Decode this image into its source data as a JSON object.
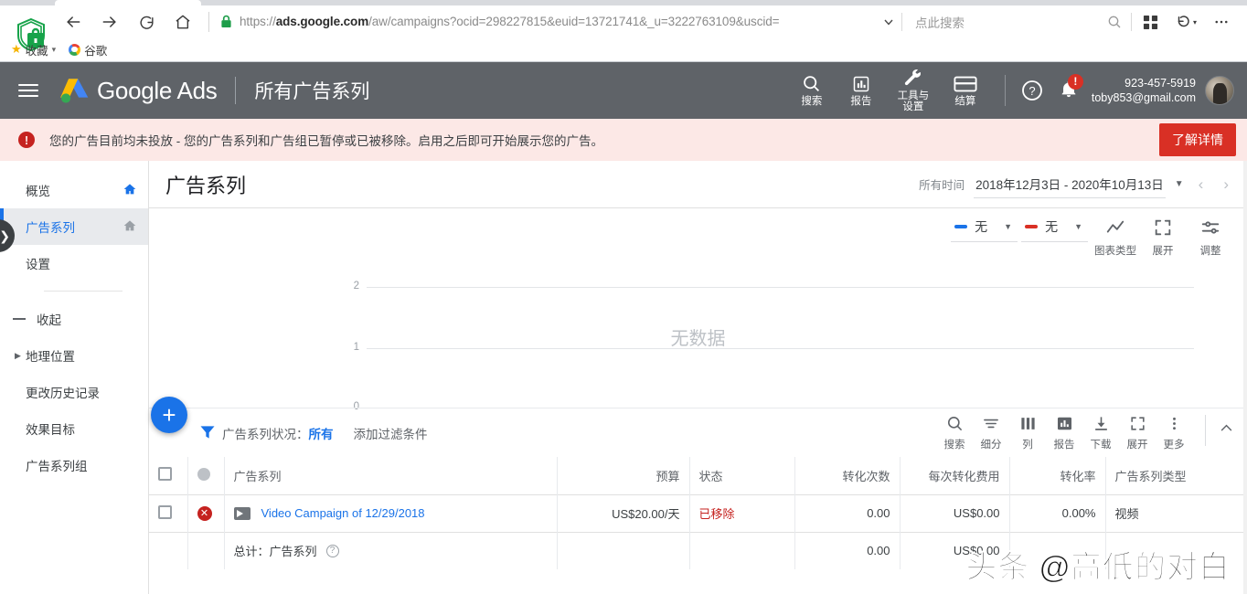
{
  "browser": {
    "url_prefix": "https://",
    "url_domain": "ads.google.com",
    "url_path": "/aw/campaigns?ocid=298227815&euid=13721741&_u=3222763109&uscid=",
    "search_placeholder": "点此搜索",
    "bookmarks": [
      {
        "label": "收藏",
        "icon": "star-icon"
      },
      {
        "label": "谷歌",
        "icon": "google-logo-icon"
      }
    ],
    "nav": {
      "back": "back-icon",
      "forward": "forward-icon",
      "reload": "reload-icon",
      "home": "home-icon"
    }
  },
  "header": {
    "brand": "Google Ads",
    "page_label": "所有广告系列",
    "tools": [
      {
        "label": "搜索",
        "icon": "search-icon"
      },
      {
        "label": "报告",
        "icon": "reports-icon"
      },
      {
        "label": "工具与\n设置",
        "line1": "工具与",
        "line2": "设置",
        "icon": "wrench-icon"
      },
      {
        "label": "结算",
        "icon": "billing-icon"
      }
    ],
    "help_icon": "help-icon",
    "notification_badge": "!",
    "account_id": "923-457-5919",
    "account_email": "toby853@gmail.com"
  },
  "alert": {
    "text": "您的广告目前均未投放 - 您的广告系列和广告组已暂停或已被移除。启用之后即可开始展示您的广告。",
    "button": "了解详情"
  },
  "sidebar": {
    "items": [
      {
        "label": "概览",
        "active": false,
        "has_home": true
      },
      {
        "label": "广告系列",
        "active": true,
        "has_home": true
      },
      {
        "label": "设置",
        "active": false,
        "has_home": false
      }
    ],
    "collapse_label": "收起",
    "sub_items": [
      {
        "label": "地理位置",
        "has_caret": true
      },
      {
        "label": "更改历史记录",
        "has_caret": false
      },
      {
        "label": "效果目标",
        "has_caret": false
      },
      {
        "label": "广告系列组",
        "has_caret": false
      }
    ]
  },
  "page": {
    "title": "广告系列",
    "date_label": "所有时间",
    "date_value": "2018年12月3日 - 2020年10月13日"
  },
  "chart_data": {
    "type": "line",
    "title": "",
    "empty_message": "无数据",
    "series": [
      {
        "name": "无",
        "color": "#1a73e8",
        "values": []
      },
      {
        "name": "无",
        "color": "#d93025",
        "values": []
      }
    ],
    "x": [],
    "categories": [],
    "yticks": [
      "2",
      "1",
      "0"
    ],
    "ylim": [
      0,
      2
    ],
    "xlabel": "",
    "ylabel": "",
    "grid": true,
    "legend": "none"
  },
  "chart_toolbar": {
    "metric1": "无",
    "metric1_color": "#1a73e8",
    "metric2": "无",
    "metric2_color": "#d93025",
    "buttons": [
      {
        "label": "图表类型",
        "icon": "line-chart-icon"
      },
      {
        "label": "展开",
        "icon": "expand-icon"
      },
      {
        "label": "调整",
        "icon": "adjust-icon"
      }
    ]
  },
  "fab": {
    "label": "+"
  },
  "filter_bar": {
    "status_label": "广告系列状况：",
    "status_value": "所有",
    "add_filter": "添加过滤条件",
    "tools": [
      {
        "label": "搜索",
        "icon": "search-icon"
      },
      {
        "label": "细分",
        "icon": "segment-icon"
      },
      {
        "label": "列",
        "icon": "columns-icon"
      },
      {
        "label": "报告",
        "icon": "reports-icon"
      },
      {
        "label": "下载",
        "icon": "download-icon"
      },
      {
        "label": "展开",
        "icon": "expand-icon"
      },
      {
        "label": "更多",
        "icon": "more-vert-icon"
      }
    ],
    "collapse_icon": "chevron-up-icon"
  },
  "table": {
    "columns": [
      {
        "key": "checkbox",
        "label": "",
        "align": "left"
      },
      {
        "key": "status_dot",
        "label": "",
        "align": "left"
      },
      {
        "key": "campaign",
        "label": "广告系列",
        "align": "left"
      },
      {
        "key": "budget",
        "label": "预算",
        "align": "right"
      },
      {
        "key": "status",
        "label": "状态",
        "align": "left"
      },
      {
        "key": "conversions",
        "label": "转化次数",
        "align": "right"
      },
      {
        "key": "cost_per_conv",
        "label": "每次转化费用",
        "align": "right"
      },
      {
        "key": "conv_rate",
        "label": "转化率",
        "align": "right"
      },
      {
        "key": "campaign_type",
        "label": "广告系列类型",
        "align": "left"
      }
    ],
    "rows": [
      {
        "campaign": "Video Campaign of 12/29/2018",
        "budget": "US$20.00/天",
        "status": "已移除",
        "conversions": "0.00",
        "cost_per_conv": "US$0.00",
        "conv_rate": "0.00%",
        "campaign_type": "视频"
      }
    ],
    "totals": {
      "label": "总计：广告系列",
      "budget": "",
      "status": "",
      "conversions": "0.00",
      "cost_per_conv": "US$0.00",
      "conv_rate": "",
      "campaign_type": ""
    }
  },
  "watermark": "头条 @高低的对白"
}
